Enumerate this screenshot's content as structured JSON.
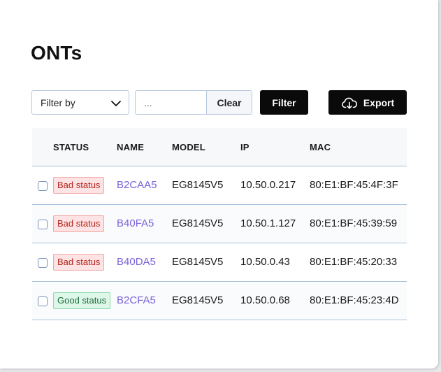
{
  "page": {
    "title": "ONTs"
  },
  "toolbar": {
    "filter_by_label": "Filter by",
    "search_placeholder": "...",
    "clear_label": "Clear",
    "filter_label": "Filter",
    "export_label": "Export"
  },
  "table": {
    "headers": {
      "status": "STATUS",
      "name": "NAME",
      "model": "MODEL",
      "ip": "IP",
      "mac": "MAC"
    },
    "rows": [
      {
        "status": "Bad status",
        "name": "B2CAA5",
        "model": "EG8145V5",
        "ip": "10.50.0.217",
        "mac": "80:E1:BF:45:4F:3F"
      },
      {
        "status": "Bad status",
        "name": "B40FA5",
        "model": "EG8145V5",
        "ip": "10.50.1.127",
        "mac": "80:E1:BF:45:39:59"
      },
      {
        "status": "Bad status",
        "name": "B40DA5",
        "model": "EG8145V5",
        "ip": "10.50.0.43",
        "mac": "80:E1:BF:45:20:33"
      },
      {
        "status": "Good status",
        "name": "B2CFA5",
        "model": "EG8145V5",
        "ip": "10.50.0.68",
        "mac": "80:E1:BF:45:23:4D"
      }
    ]
  },
  "colors": {
    "accent_link": "#7b62d9",
    "bad_status_bg": "#fde3e3",
    "good_status_bg": "#ddf7e8",
    "primary_button": "#0a0a0a"
  }
}
